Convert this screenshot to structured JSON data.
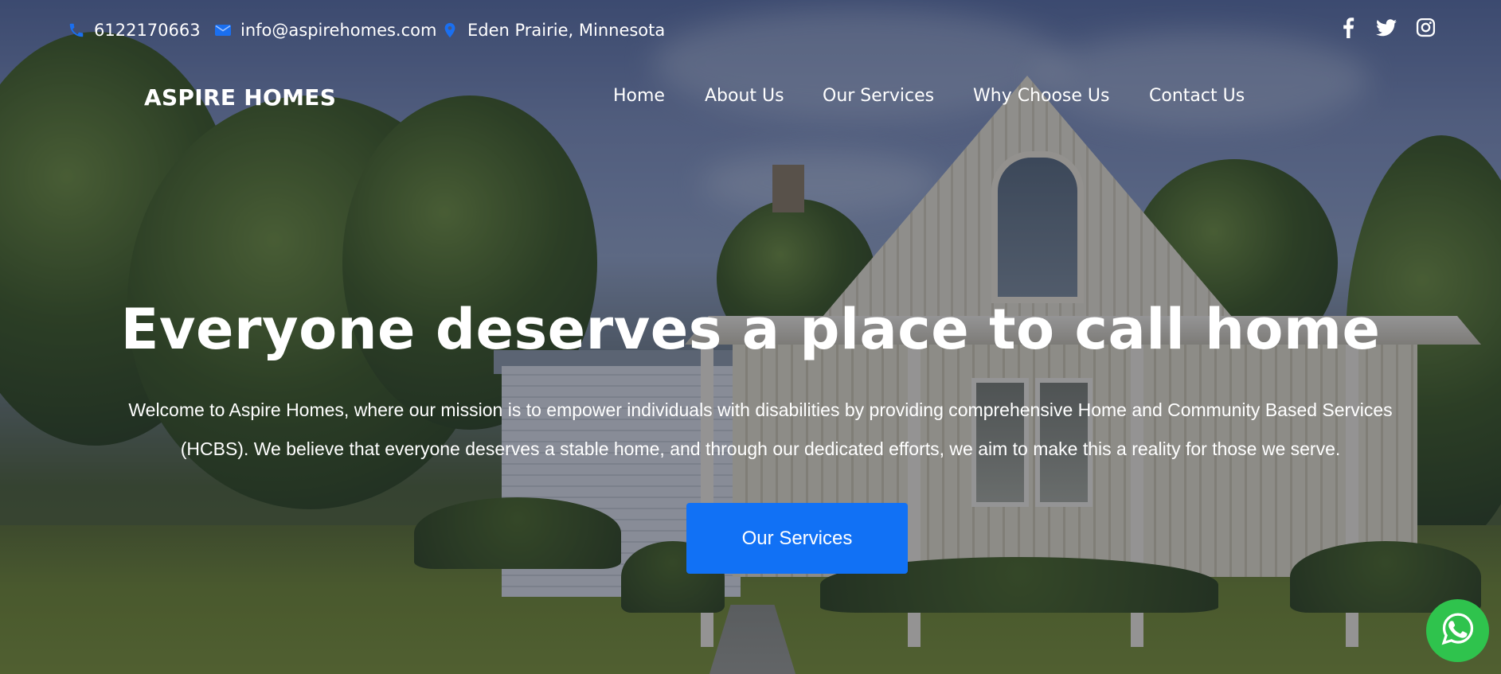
{
  "topbar": {
    "phone": "6122170663",
    "email": "info@aspirehomes.com",
    "location": "Eden Prairie, Minnesota",
    "icon_color": "#1a6ff0",
    "social": [
      {
        "icon": "facebook-icon"
      },
      {
        "icon": "twitter-icon"
      },
      {
        "icon": "instagram-icon"
      }
    ]
  },
  "brand": {
    "name": "ASPIRE HOMES"
  },
  "nav": {
    "items": [
      {
        "label": "Home"
      },
      {
        "label": "About Us"
      },
      {
        "label": "Our Services"
      },
      {
        "label": "Why Choose Us"
      },
      {
        "label": "Contact Us"
      }
    ]
  },
  "hero": {
    "title": "Everyone deserves a place to call home",
    "text": "Welcome to Aspire Homes, where our mission is to empower individuals with disabilities by providing comprehensive Home and Community Based Services (HCBS). We believe that everyone deserves a stable home, and through our dedicated efforts, we aim to make this a reality for those we serve.",
    "cta_label": "Our Services",
    "cta_color": "#1171f5"
  },
  "whatsapp": {
    "icon": "whatsapp-icon",
    "color": "#2fc34d"
  }
}
